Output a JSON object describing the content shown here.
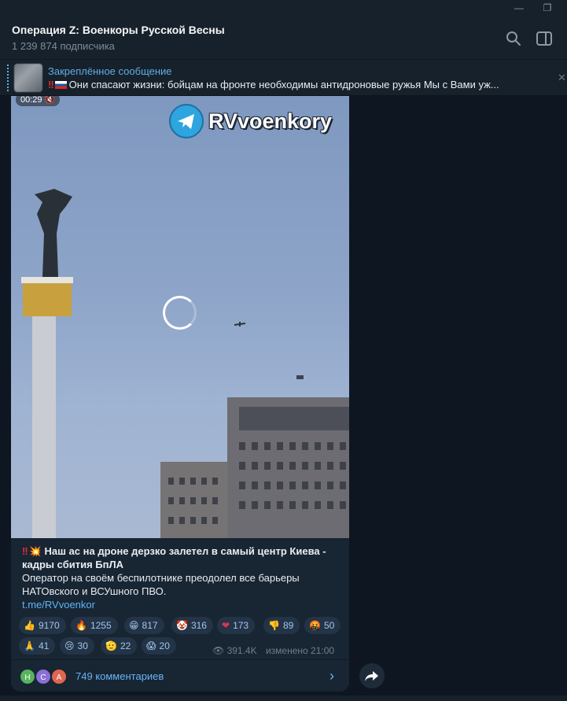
{
  "window": {
    "minimize": "—",
    "restore": "❐"
  },
  "header": {
    "title": "Операция Z: Военкоры Русской Весны",
    "subtitle": "1 239 874 подписчика",
    "search_icon": "search-icon",
    "sidebar_icon": "sidebar-toggle-icon"
  },
  "pinned": {
    "label": "Закреплённое сообщение",
    "text": "Они спасают жизни: бойцам на фронте необходимы антидроновые ружья Мы с Вами уж..."
  },
  "message": {
    "video_time": "00:29",
    "watermark": "RVvoenkory",
    "caption_title": "Наш ас на дроне дерзко залетел в самый центр Киева - кадры сбития БпЛА",
    "caption_body": "Оператор на своём беспилотнике преодолел все барьеры НАТОвского и ВСУшного ПВО.",
    "link": "t.me/RVvoenkor",
    "reactions": [
      {
        "emoji": "👍",
        "count": "9170"
      },
      {
        "emoji": "🔥",
        "count": "1255"
      },
      {
        "emoji": "😁",
        "count": "817"
      },
      {
        "emoji": "🤡",
        "count": "316"
      },
      {
        "emoji": "❤",
        "count": "173"
      },
      {
        "emoji": "👎",
        "count": "89"
      },
      {
        "emoji": "🤬",
        "count": "50"
      },
      {
        "emoji": "🙏",
        "count": "41"
      },
      {
        "emoji": "😢",
        "count": "30"
      },
      {
        "emoji": "🫡",
        "count": "22"
      },
      {
        "emoji": "😱",
        "count": "20"
      }
    ],
    "views": "391.4K",
    "edited": "изменено 21:00",
    "comments": "749 комментариев",
    "avatars": [
      "Н",
      "С",
      "А"
    ],
    "avatar_colors": [
      "#56b45e",
      "#8c6fd6",
      "#e0664f"
    ]
  },
  "colors": {
    "accent": "#5eb5f7",
    "bubble": "#182533",
    "background": "#0e1621"
  }
}
